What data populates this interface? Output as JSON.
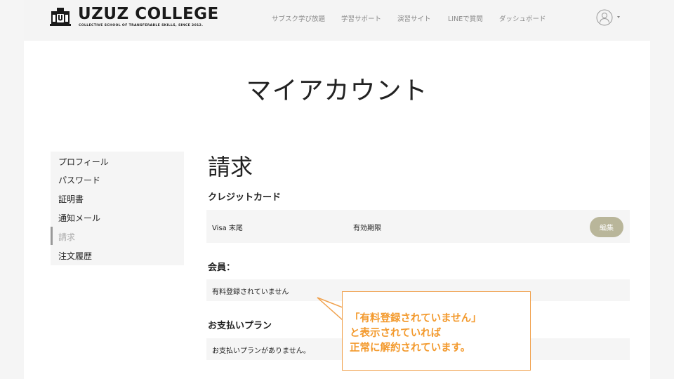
{
  "header": {
    "logo_text": "UZUZ COLLEGE",
    "logo_tagline": "COLLECTIVE SCHOOL OF TRANSFERABLE SKILLS, SINCE 2012.",
    "nav": [
      "サブスク学び放題",
      "学習サポート",
      "演習サイト",
      "LINEで質問",
      "ダッシュボード"
    ],
    "user_icon": "user-avatar-icon",
    "caret_icon": "caret-down-icon"
  },
  "page_title": "マイアカウント",
  "sidebar": {
    "items": [
      "プロフィール",
      "パスワード",
      "証明書",
      "通知メール",
      "請求",
      "注文履歴"
    ],
    "active": "請求"
  },
  "billing": {
    "title": "請求",
    "credit_card": {
      "heading": "クレジットカード",
      "card_label": "Visa 末尾",
      "expiry_label": "有効期限",
      "edit_label": "編集"
    },
    "membership": {
      "heading": "会員：",
      "status": "有料登録されていません"
    },
    "plan": {
      "heading": "お支払いプラン",
      "status": "お支払いプランがありません。"
    }
  },
  "callout": {
    "lines": [
      "「有料登録されていません」",
      "と表示されていれば",
      "正常に解約されています。"
    ]
  },
  "colors": {
    "accent_button": "#b9b69a",
    "callout_border": "#f0a04b",
    "callout_text": "#f39a2e",
    "panel_bg": "#f5f5f5",
    "header_bg": "#f4f4f4"
  }
}
